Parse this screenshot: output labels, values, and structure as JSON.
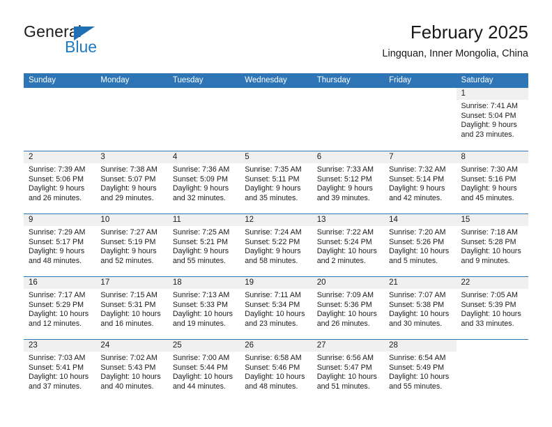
{
  "brand": {
    "name_top": "General",
    "name_bottom": "Blue",
    "triangle_icon": "triangle-icon",
    "colors": {
      "blue": "#1f7ac4",
      "triangle": "#1f6fb5",
      "dark": "#1c1c1c"
    }
  },
  "header": {
    "title": "February 2025",
    "location": "Lingquan, Inner Mongolia, China"
  },
  "theme": {
    "header_blue": "#2e75b6",
    "daynum_band": "#f0f0f0",
    "text": "#1a1a1a"
  },
  "calendar": {
    "weekday_headers": [
      "Sunday",
      "Monday",
      "Tuesday",
      "Wednesday",
      "Thursday",
      "Friday",
      "Saturday"
    ],
    "labels": {
      "sunrise": "Sunrise:",
      "sunset": "Sunset:",
      "daylight": "Daylight:"
    },
    "weeks": [
      [
        {
          "empty": true
        },
        {
          "empty": true
        },
        {
          "empty": true
        },
        {
          "empty": true
        },
        {
          "empty": true
        },
        {
          "empty": true
        },
        {
          "day": "1",
          "sunrise": "Sunrise: 7:41 AM",
          "sunset": "Sunset: 5:04 PM",
          "daylight": "Daylight: 9 hours and 23 minutes."
        }
      ],
      [
        {
          "day": "2",
          "sunrise": "Sunrise: 7:39 AM",
          "sunset": "Sunset: 5:06 PM",
          "daylight": "Daylight: 9 hours and 26 minutes."
        },
        {
          "day": "3",
          "sunrise": "Sunrise: 7:38 AM",
          "sunset": "Sunset: 5:07 PM",
          "daylight": "Daylight: 9 hours and 29 minutes."
        },
        {
          "day": "4",
          "sunrise": "Sunrise: 7:36 AM",
          "sunset": "Sunset: 5:09 PM",
          "daylight": "Daylight: 9 hours and 32 minutes."
        },
        {
          "day": "5",
          "sunrise": "Sunrise: 7:35 AM",
          "sunset": "Sunset: 5:11 PM",
          "daylight": "Daylight: 9 hours and 35 minutes."
        },
        {
          "day": "6",
          "sunrise": "Sunrise: 7:33 AM",
          "sunset": "Sunset: 5:12 PM",
          "daylight": "Daylight: 9 hours and 39 minutes."
        },
        {
          "day": "7",
          "sunrise": "Sunrise: 7:32 AM",
          "sunset": "Sunset: 5:14 PM",
          "daylight": "Daylight: 9 hours and 42 minutes."
        },
        {
          "day": "8",
          "sunrise": "Sunrise: 7:30 AM",
          "sunset": "Sunset: 5:16 PM",
          "daylight": "Daylight: 9 hours and 45 minutes."
        }
      ],
      [
        {
          "day": "9",
          "sunrise": "Sunrise: 7:29 AM",
          "sunset": "Sunset: 5:17 PM",
          "daylight": "Daylight: 9 hours and 48 minutes."
        },
        {
          "day": "10",
          "sunrise": "Sunrise: 7:27 AM",
          "sunset": "Sunset: 5:19 PM",
          "daylight": "Daylight: 9 hours and 52 minutes."
        },
        {
          "day": "11",
          "sunrise": "Sunrise: 7:25 AM",
          "sunset": "Sunset: 5:21 PM",
          "daylight": "Daylight: 9 hours and 55 minutes."
        },
        {
          "day": "12",
          "sunrise": "Sunrise: 7:24 AM",
          "sunset": "Sunset: 5:22 PM",
          "daylight": "Daylight: 9 hours and 58 minutes."
        },
        {
          "day": "13",
          "sunrise": "Sunrise: 7:22 AM",
          "sunset": "Sunset: 5:24 PM",
          "daylight": "Daylight: 10 hours and 2 minutes."
        },
        {
          "day": "14",
          "sunrise": "Sunrise: 7:20 AM",
          "sunset": "Sunset: 5:26 PM",
          "daylight": "Daylight: 10 hours and 5 minutes."
        },
        {
          "day": "15",
          "sunrise": "Sunrise: 7:18 AM",
          "sunset": "Sunset: 5:28 PM",
          "daylight": "Daylight: 10 hours and 9 minutes."
        }
      ],
      [
        {
          "day": "16",
          "sunrise": "Sunrise: 7:17 AM",
          "sunset": "Sunset: 5:29 PM",
          "daylight": "Daylight: 10 hours and 12 minutes."
        },
        {
          "day": "17",
          "sunrise": "Sunrise: 7:15 AM",
          "sunset": "Sunset: 5:31 PM",
          "daylight": "Daylight: 10 hours and 16 minutes."
        },
        {
          "day": "18",
          "sunrise": "Sunrise: 7:13 AM",
          "sunset": "Sunset: 5:33 PM",
          "daylight": "Daylight: 10 hours and 19 minutes."
        },
        {
          "day": "19",
          "sunrise": "Sunrise: 7:11 AM",
          "sunset": "Sunset: 5:34 PM",
          "daylight": "Daylight: 10 hours and 23 minutes."
        },
        {
          "day": "20",
          "sunrise": "Sunrise: 7:09 AM",
          "sunset": "Sunset: 5:36 PM",
          "daylight": "Daylight: 10 hours and 26 minutes."
        },
        {
          "day": "21",
          "sunrise": "Sunrise: 7:07 AM",
          "sunset": "Sunset: 5:38 PM",
          "daylight": "Daylight: 10 hours and 30 minutes."
        },
        {
          "day": "22",
          "sunrise": "Sunrise: 7:05 AM",
          "sunset": "Sunset: 5:39 PM",
          "daylight": "Daylight: 10 hours and 33 minutes."
        }
      ],
      [
        {
          "day": "23",
          "sunrise": "Sunrise: 7:03 AM",
          "sunset": "Sunset: 5:41 PM",
          "daylight": "Daylight: 10 hours and 37 minutes."
        },
        {
          "day": "24",
          "sunrise": "Sunrise: 7:02 AM",
          "sunset": "Sunset: 5:43 PM",
          "daylight": "Daylight: 10 hours and 40 minutes."
        },
        {
          "day": "25",
          "sunrise": "Sunrise: 7:00 AM",
          "sunset": "Sunset: 5:44 PM",
          "daylight": "Daylight: 10 hours and 44 minutes."
        },
        {
          "day": "26",
          "sunrise": "Sunrise: 6:58 AM",
          "sunset": "Sunset: 5:46 PM",
          "daylight": "Daylight: 10 hours and 48 minutes."
        },
        {
          "day": "27",
          "sunrise": "Sunrise: 6:56 AM",
          "sunset": "Sunset: 5:47 PM",
          "daylight": "Daylight: 10 hours and 51 minutes."
        },
        {
          "day": "28",
          "sunrise": "Sunrise: 6:54 AM",
          "sunset": "Sunset: 5:49 PM",
          "daylight": "Daylight: 10 hours and 55 minutes."
        },
        {
          "empty": true
        }
      ]
    ]
  }
}
